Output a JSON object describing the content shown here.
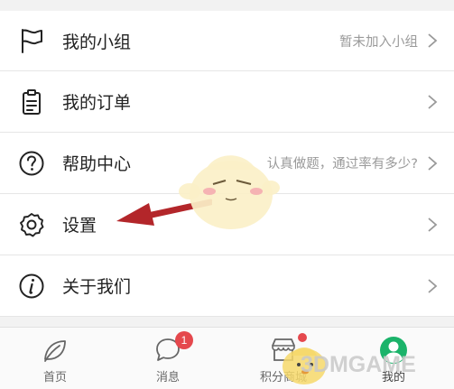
{
  "menu": {
    "items": [
      {
        "icon": "flag-icon",
        "label": "我的小组",
        "right_text": "暂未加入小组"
      },
      {
        "icon": "clipboard-icon",
        "label": "我的订单",
        "right_text": ""
      },
      {
        "icon": "help-circle-icon",
        "label": "帮助中心",
        "right_text": "认真做题，通过率有多少?"
      },
      {
        "icon": "gear-icon",
        "label": "设置",
        "right_text": ""
      },
      {
        "icon": "info-circle-icon",
        "label": "关于我们",
        "right_text": ""
      }
    ]
  },
  "tabbar": {
    "tabs": [
      {
        "icon": "leaf-icon",
        "label": "首页"
      },
      {
        "icon": "chat-bubble-icon",
        "label": "消息",
        "badge": "1"
      },
      {
        "icon": "store-icon",
        "label": "积分商城"
      },
      {
        "icon": "profile-icon",
        "label": "我的"
      }
    ]
  },
  "colors": {
    "badge": "#e5484d",
    "active_tab": "#1bb36a",
    "arrow": "#b3262a"
  },
  "watermark": "3DMGAME"
}
